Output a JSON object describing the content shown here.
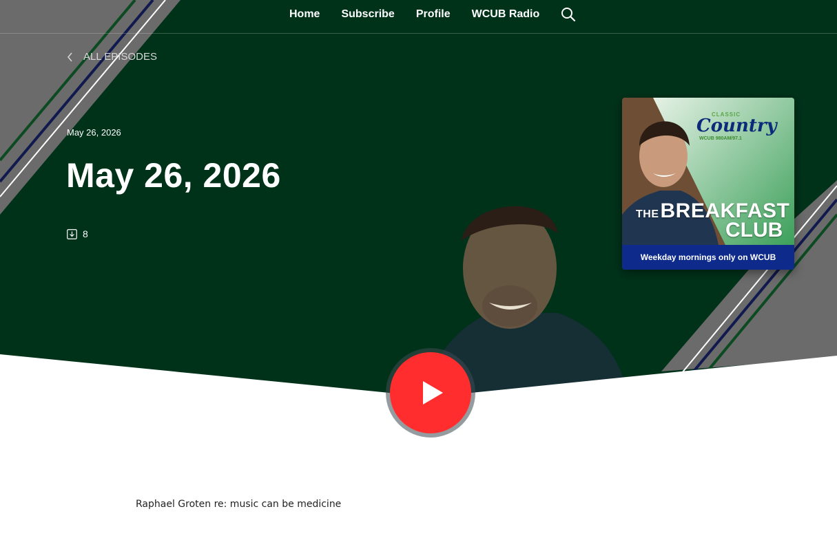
{
  "nav": {
    "items": [
      "Home",
      "Subscribe",
      "Profile",
      "WCUB Radio"
    ]
  },
  "back_link": "ALL EPISODES",
  "episode": {
    "date_label": "May 26, 2026",
    "title": "May 26, 2026",
    "downloads": "8",
    "description": "Raphael Groten re:  music can be medicine"
  },
  "cover": {
    "brand_small": "CLASSIC",
    "brand_name": "Country",
    "brand_sub": "WCUB 980AM/97.1",
    "title_prefix": "THE",
    "title_word1": "BREAKFAST",
    "title_word2": "CLUB",
    "tagline": "Weekday mornings only on WCUB"
  },
  "colors": {
    "hero_bg": "#00321a",
    "play_button": "#ff2d2d",
    "cover_band": "#0e2b8c",
    "stripe_grey": "#6b6b6b",
    "stripe_navy": "#101a4e"
  },
  "icons": {
    "search": "search-icon",
    "back": "chevron-left-icon",
    "download": "download-icon",
    "play": "play-icon"
  }
}
